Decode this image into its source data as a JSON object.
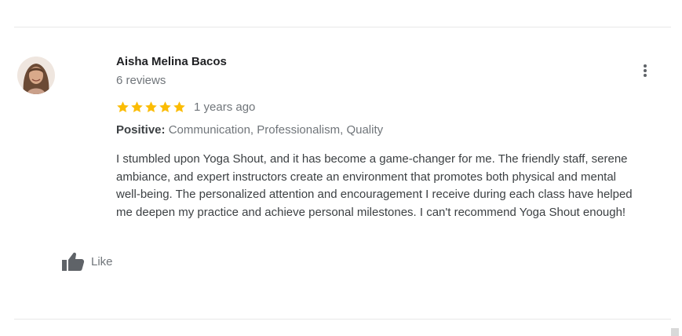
{
  "review": {
    "author_name": "Aisha Melina Bacos",
    "review_count": "6 reviews",
    "rating": 5,
    "rating_max": 5,
    "time_ago": "1 years ago",
    "attributes_label": "Positive:",
    "attributes_value": "Communication, Professionalism, Quality",
    "text_lines": [
      "I stumbled upon Yoga Shout, and it has become a game-changer for me. The friendly staff, serene",
      "ambiance, and expert instructors create an environment that promotes both physical and mental",
      "well-being. The personalized attention and encouragement I receive during each class have helped",
      "me deepen my practice and achieve personal milestones. I can't recommend Yoga Shout enough!"
    ]
  },
  "actions": {
    "like_label": "Like"
  },
  "icons": {
    "more": "more-vertical-icon",
    "like": "thumbs-up-icon",
    "star": "star-icon"
  },
  "colors": {
    "star": "#fbbc04",
    "name": "#202124",
    "secondary": "#70757a",
    "body": "#3c4043"
  }
}
